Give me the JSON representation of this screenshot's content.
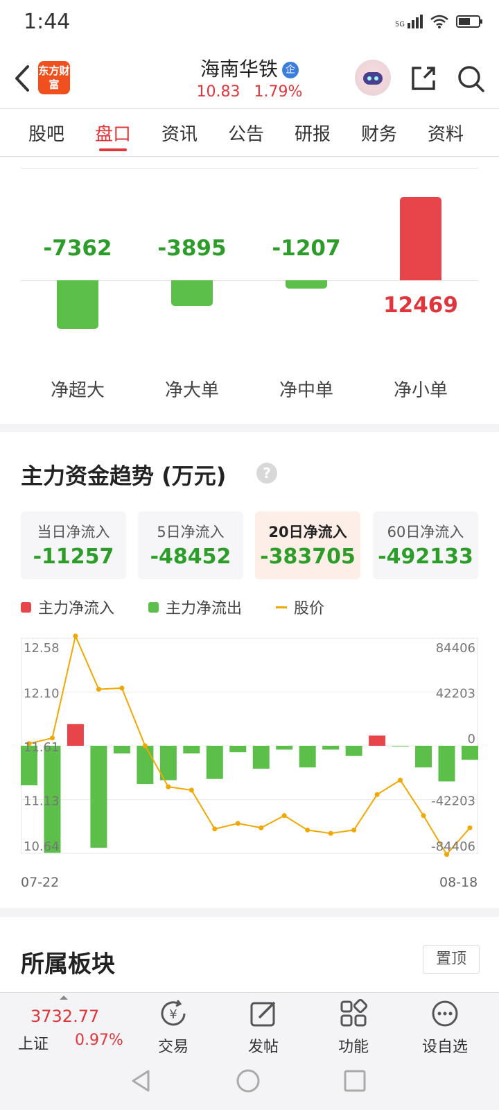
{
  "status_bar": {
    "time": "1:44",
    "network": "5G"
  },
  "header": {
    "logo_text": "东方财富",
    "stock_name": "海南华铁",
    "badge": "企",
    "price": "10.83",
    "change_pct": "1.79%"
  },
  "tabs": [
    {
      "label": "股吧"
    },
    {
      "label": "盘口",
      "active": true
    },
    {
      "label": "资讯"
    },
    {
      "label": "公告"
    },
    {
      "label": "研报"
    },
    {
      "label": "财务"
    },
    {
      "label": "资料"
    }
  ],
  "order_flow": {
    "items": [
      {
        "label": "净超大",
        "value": -7362,
        "display": "-7362"
      },
      {
        "label": "净大单",
        "value": -3895,
        "display": "-3895"
      },
      {
        "label": "净中单",
        "value": -1207,
        "display": "-1207"
      },
      {
        "label": "净小单",
        "value": 12469,
        "display": "12469"
      }
    ]
  },
  "trend": {
    "title": "主力资金趋势 (万元)",
    "help": "?",
    "stats": [
      {
        "label": "当日净流入",
        "value": "-11257"
      },
      {
        "label": "5日净流入",
        "value": "-48452"
      },
      {
        "label": "20日净流入",
        "value": "-383705",
        "active": true
      },
      {
        "label": "60日净流入",
        "value": "-492133"
      }
    ],
    "legend": {
      "inflow": "主力净流入",
      "outflow": "主力净流出",
      "price": "股价"
    },
    "date_start": "07-22",
    "date_end": "08-18"
  },
  "chart_data": {
    "type": "bar",
    "x": [
      "07-22",
      "",
      "",
      "",
      "",
      "",
      "",
      "",
      "",
      "",
      "",
      "",
      "",
      "",
      "",
      "",
      "",
      "",
      "",
      "08-18"
    ],
    "series": [
      {
        "name": "主力净流入",
        "values": [
          -31000,
          -84000,
          17000,
          -80000,
          -6000,
          -30000,
          -27000,
          -6000,
          -26000,
          -5000,
          -18000,
          -3000,
          -17000,
          -3000,
          -8000,
          8000,
          -500,
          -17000,
          -28000,
          -11000
        ]
      },
      {
        "name": "股价",
        "values": [
          11.63,
          11.68,
          12.6,
          12.12,
          12.13,
          11.61,
          11.24,
          11.21,
          10.86,
          10.91,
          10.87,
          10.98,
          10.85,
          10.82,
          10.85,
          11.17,
          11.3,
          10.98,
          10.63,
          10.87
        ]
      }
    ],
    "left_axis_ticks": [
      "12.58",
      "12.10",
      "11.61",
      "11.13",
      "10.64"
    ],
    "right_axis_ticks": [
      "84406",
      "42203",
      "0",
      "-42203",
      "-84406"
    ],
    "price_range": [
      10.64,
      12.58
    ],
    "flow_range": [
      -84406,
      84406
    ],
    "colors": {
      "inflow": "#e8454a",
      "outflow": "#5bbf4a",
      "price": "#f0a800"
    }
  },
  "sector": {
    "title": "所属板块",
    "pin_label": "置顶"
  },
  "toolbar": {
    "index_value": "3732.77",
    "index_name": "上证",
    "index_pct": "0.97%",
    "items": [
      {
        "label": "交易",
        "icon": "trade-icon"
      },
      {
        "label": "发帖",
        "icon": "post-icon"
      },
      {
        "label": "功能",
        "icon": "grid-icon"
      },
      {
        "label": "设自选",
        "icon": "more-icon"
      }
    ]
  }
}
